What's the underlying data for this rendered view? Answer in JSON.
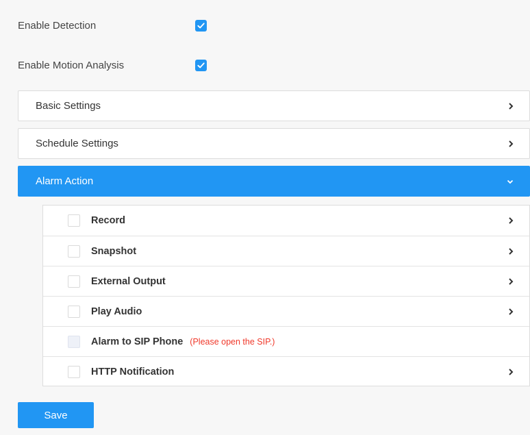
{
  "toggles": {
    "enable_detection": {
      "label": "Enable Detection",
      "checked": true
    },
    "enable_motion_analysis": {
      "label": "Enable Motion Analysis",
      "checked": true
    }
  },
  "sections": {
    "basic_settings": "Basic Settings",
    "schedule_settings": "Schedule Settings",
    "alarm_action": "Alarm Action"
  },
  "alarm_actions": {
    "record": {
      "label": "Record",
      "checked": false
    },
    "snapshot": {
      "label": "Snapshot",
      "checked": false
    },
    "external_output": {
      "label": "External Output",
      "checked": false
    },
    "play_audio": {
      "label": "Play Audio",
      "checked": false
    },
    "sip_phone": {
      "label": "Alarm to SIP Phone",
      "hint": "(Please open the SIP.)",
      "checked": false,
      "disabled": true
    },
    "http_notification": {
      "label": "HTTP Notification",
      "checked": false
    }
  },
  "save_label": "Save",
  "colors": {
    "accent": "#2196f3",
    "warning": "#f0382a"
  }
}
